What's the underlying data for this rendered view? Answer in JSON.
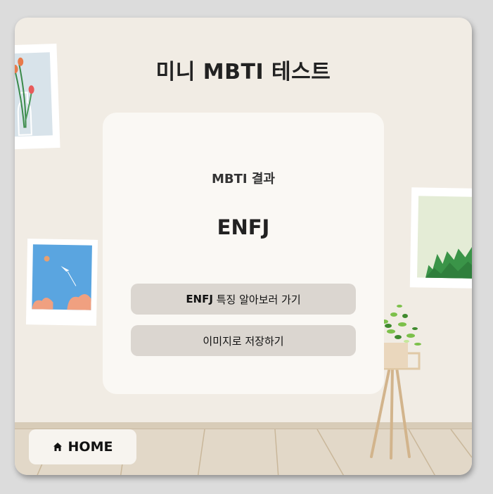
{
  "header": {
    "title": "미니 MBTI 테스트"
  },
  "result": {
    "label": "MBTI 결과",
    "type": "ENFJ"
  },
  "buttons": {
    "traits_type": "ENFJ",
    "traits_rest": " 특징 알아보러 가기",
    "save_image": "이미지로 저장하기"
  },
  "nav": {
    "home_label": "HOME",
    "home_icon": "home-icon"
  },
  "colors": {
    "wall": "#f1ece4",
    "floor": "#e2d8c8",
    "card": "#faf8f4",
    "button": "#dbd6d0"
  }
}
